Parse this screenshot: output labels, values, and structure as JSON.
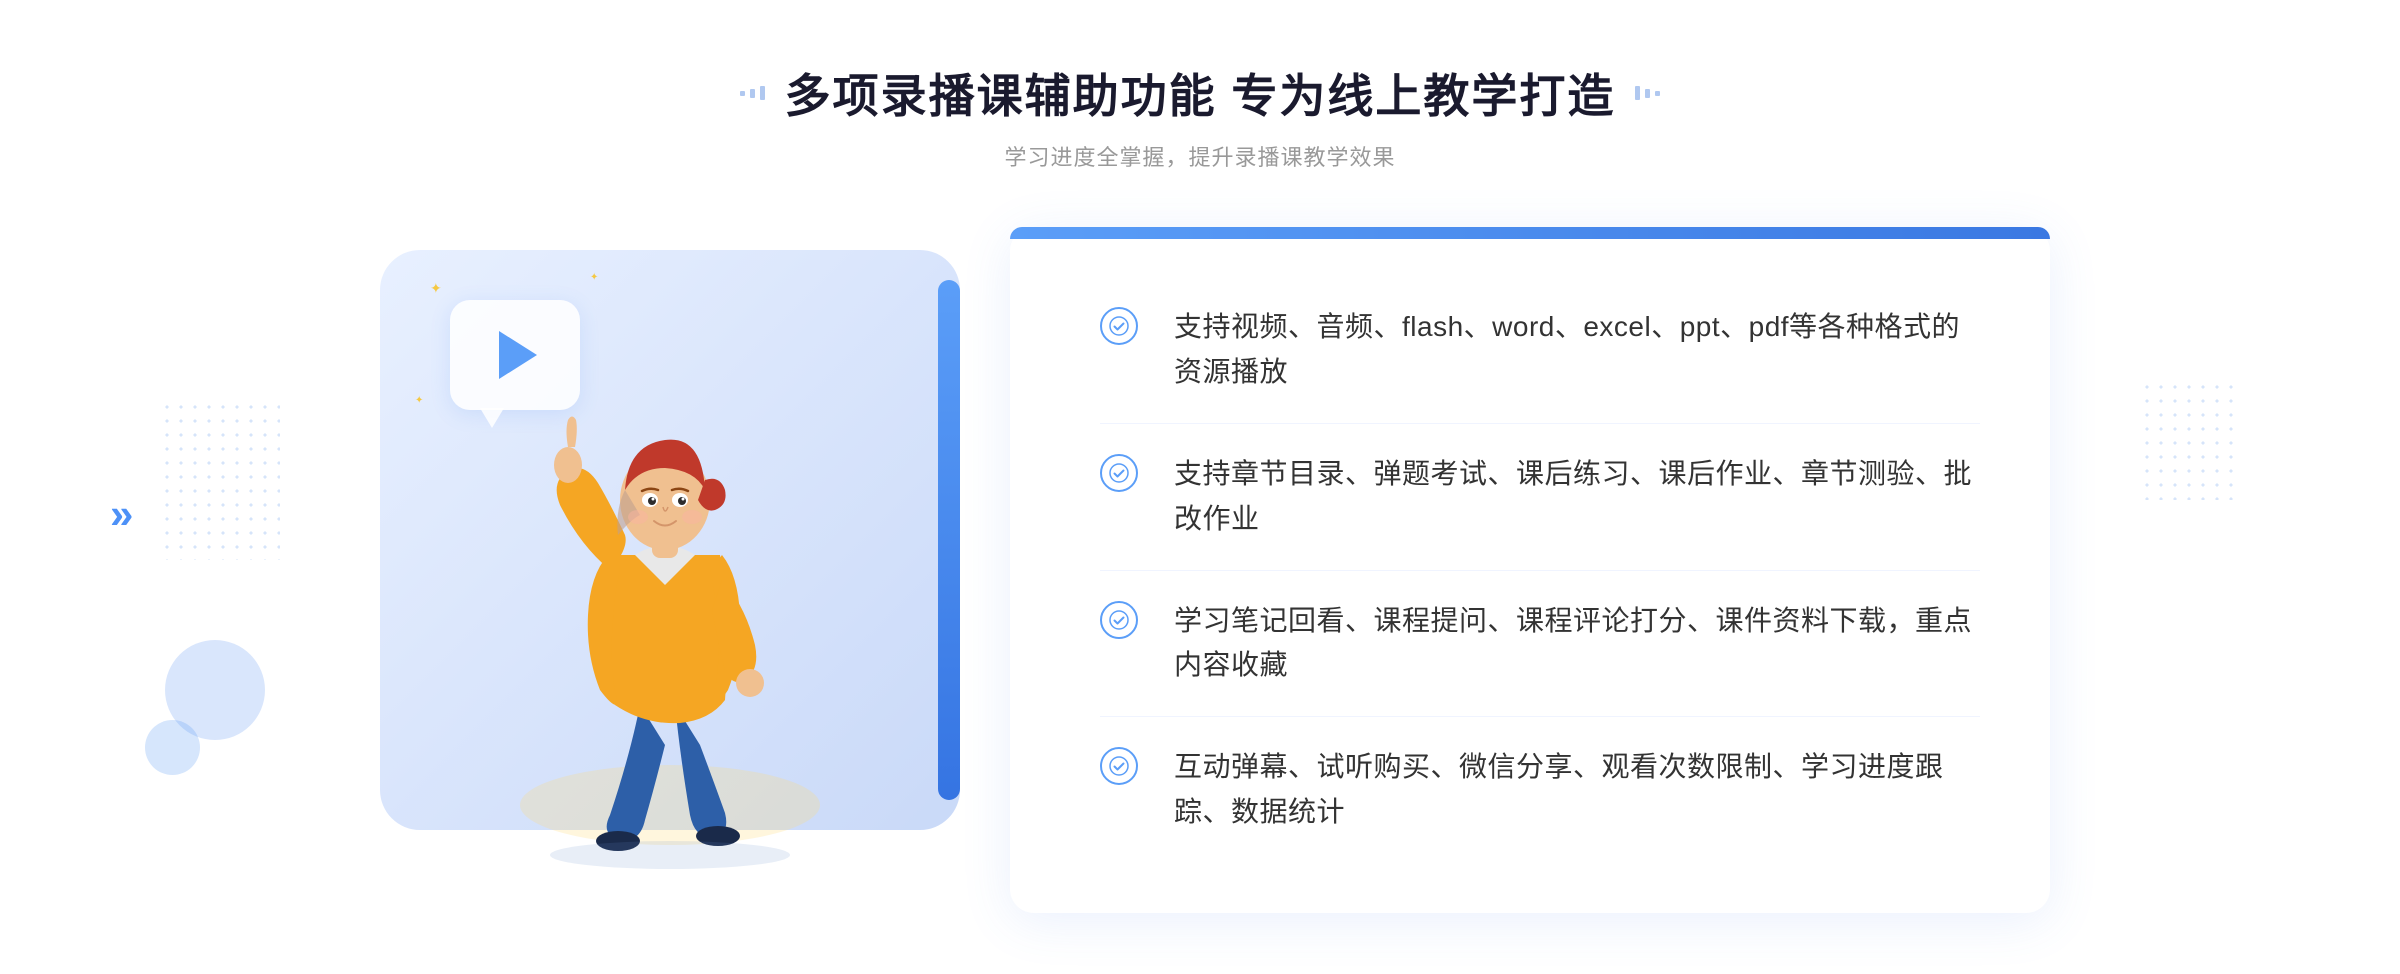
{
  "header": {
    "main_title": "多项录播课辅助功能 专为线上教学打造",
    "sub_title": "学习进度全掌握，提升录播课教学效果"
  },
  "features": [
    {
      "id": 1,
      "text": "支持视频、音频、flash、word、excel、ppt、pdf等各种格式的资源播放"
    },
    {
      "id": 2,
      "text": "支持章节目录、弹题考试、课后练习、课后作业、章节测验、批改作业"
    },
    {
      "id": 3,
      "text": "学习笔记回看、课程提问、课程评论打分、课件资料下载，重点内容收藏"
    },
    {
      "id": 4,
      "text": "互动弹幕、试听购买、微信分享、观看次数限制、学习进度跟踪、数据统计"
    }
  ]
}
